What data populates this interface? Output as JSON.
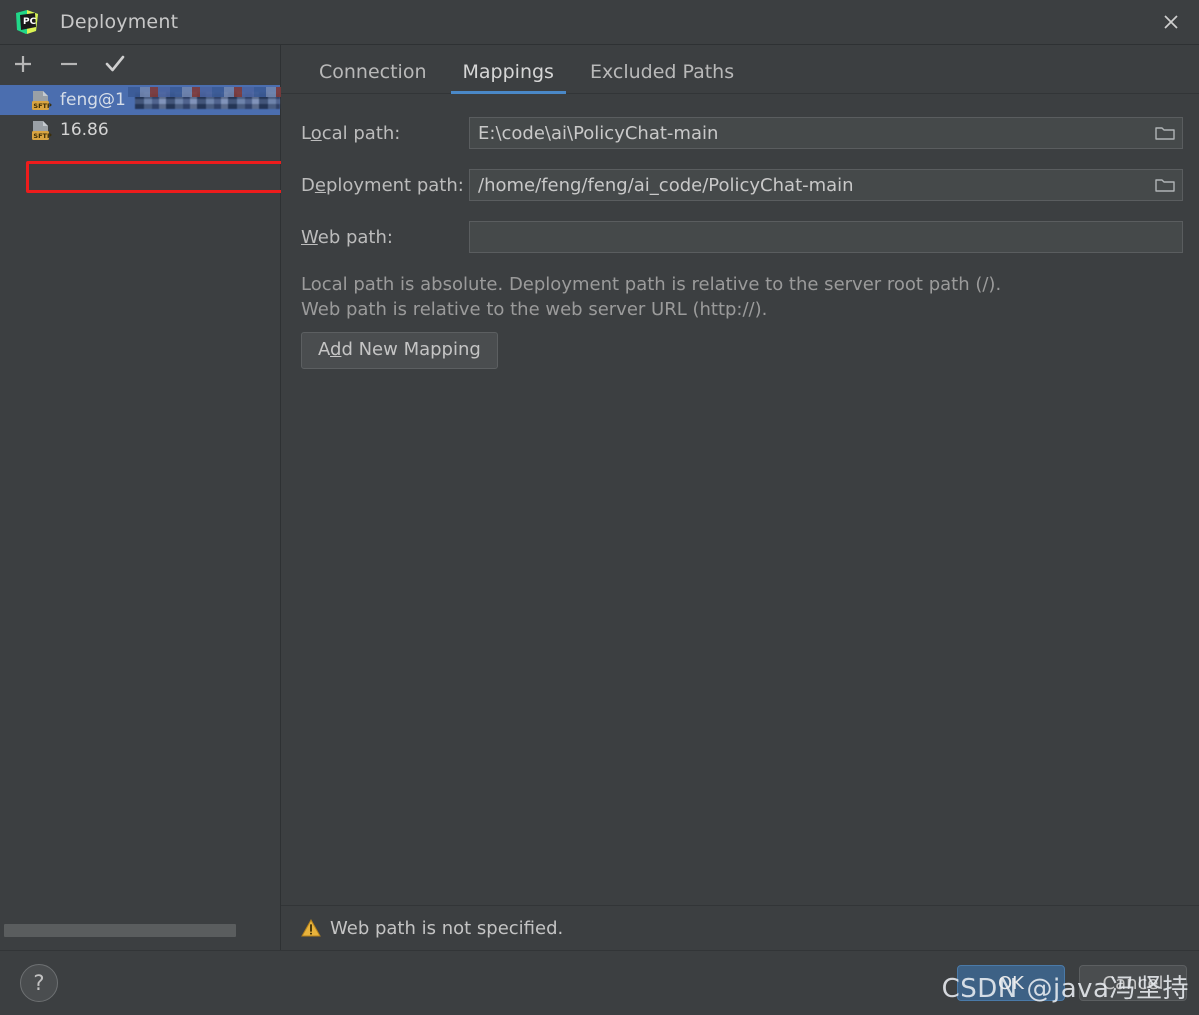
{
  "window": {
    "title": "Deployment",
    "app_icon": "pycharm-logo-icon",
    "close_icon": "close-icon"
  },
  "left_panel": {
    "toolbar": [
      {
        "icon": "plus-icon",
        "name": "add-server-button"
      },
      {
        "icon": "minus-icon",
        "name": "remove-server-button"
      },
      {
        "icon": "check-icon",
        "name": "set-default-server-button"
      }
    ],
    "servers": [
      {
        "label_prefix": "feng@1",
        "label_redacted": true,
        "icon": "sftp-icon",
        "selected": true
      },
      {
        "label_prefix": "16.86",
        "label_redacted": false,
        "icon": "sftp-icon",
        "selected": false
      }
    ],
    "annotation": {
      "type": "red-rectangle",
      "color": "#ee1c1c"
    }
  },
  "tabs": [
    {
      "label": "Connection",
      "active": false
    },
    {
      "label": "Mappings",
      "active": true
    },
    {
      "label": "Excluded Paths",
      "active": false
    }
  ],
  "mappings": {
    "local_path": {
      "label_pre": "L",
      "label_mn": "o",
      "label_post": "cal path:",
      "value": "E:\\code\\ai\\PolicyChat-main",
      "placeholder": "",
      "browse_icon": "folder-icon"
    },
    "deployment_path": {
      "label_pre": "D",
      "label_mn": "e",
      "label_post": "ployment path:",
      "value": "/home/feng/feng/ai_code/PolicyChat-main",
      "placeholder": "",
      "browse_icon": "folder-icon"
    },
    "web_path": {
      "label_pre": "",
      "label_mn": "W",
      "label_post": "eb path:",
      "value": "",
      "placeholder": "",
      "browse_icon": ""
    },
    "hint_line1": "Local path is absolute. Deployment path is relative to the server root path (/).",
    "hint_line2": "Web path is relative to the web server URL (http://).",
    "add_button": {
      "pre": "A",
      "mn": "d",
      "post": "d New Mapping"
    }
  },
  "status": {
    "icon": "warning-triangle-icon",
    "text": "Web path is not specified."
  },
  "footer": {
    "help_label": "?",
    "help_icon": "question-mark-icon",
    "ok_label": "OK",
    "cancel_label": "Cancel"
  },
  "watermark": "CSDN @java冯坚持",
  "colors": {
    "background": "#3c3f41",
    "selection": "#4b6eaf",
    "tab_accent": "#4a88c7",
    "ok_button": "#3d6185",
    "annotation_red": "#ee1c1c",
    "warning_yellow": "#e8b33c",
    "sftp_badge": "#d9a441"
  }
}
